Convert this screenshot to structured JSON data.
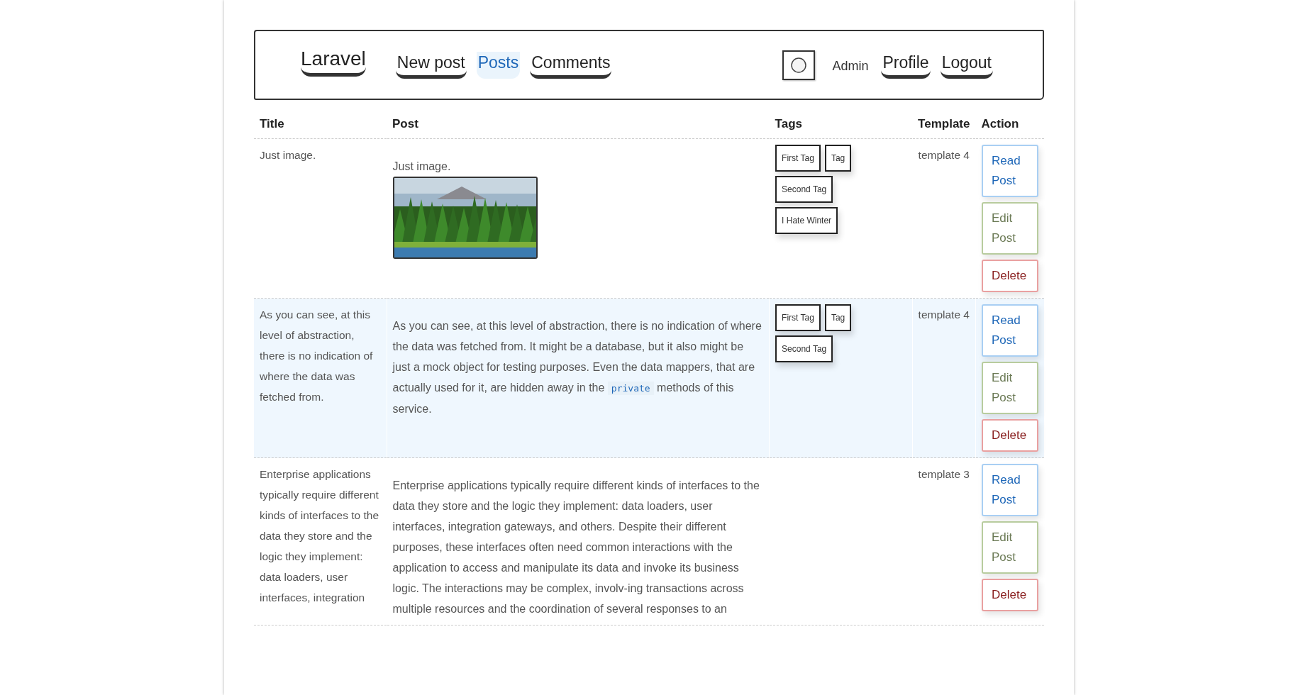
{
  "navbar": {
    "brand": "Laravel",
    "links": [
      {
        "label": "New post",
        "active": false
      },
      {
        "label": "Posts",
        "active": true
      },
      {
        "label": "Comments",
        "active": false
      }
    ],
    "user": {
      "name": "Admin"
    },
    "user_links": [
      {
        "label": "Profile",
        "active": false
      },
      {
        "label": "Logout",
        "active": false
      }
    ]
  },
  "table": {
    "columns": [
      "Title",
      "Post",
      "Tags",
      "Template",
      "Action"
    ],
    "rows": [
      {
        "highlighted": false,
        "title": "Just image.",
        "post": [
          {
            "kind": "text",
            "text": "Just image."
          }
        ],
        "media": [
          {
            "kind": "picture"
          }
        ],
        "tags": [
          "First Tag",
          "Tag",
          "Second Tag",
          "I Hate Winter"
        ],
        "template": "template 4",
        "actions": [
          {
            "kind": "read",
            "label": "Read Post"
          },
          {
            "kind": "edit",
            "label": "Edit Post"
          },
          {
            "kind": "delete",
            "label": "Delete"
          }
        ]
      },
      {
        "highlighted": true,
        "title": "As you can see, at this level of abstraction, there is no indication of where the data was fetched from.",
        "post": [
          {
            "kind": "text",
            "text": "As you can see, at this level of abstraction, there is no indication of where the data was fetched from. It might be a database, but it also might be just a mock object for testing purposes. Even the data mappers, that are actually used for it, are hidden away in the "
          },
          {
            "kind": "code",
            "text": "private"
          },
          {
            "kind": "text",
            "text": " methods of this service."
          }
        ],
        "tags": [
          "First Tag",
          "Tag",
          "Second Tag"
        ],
        "template": "template 4",
        "actions": [
          {
            "kind": "read",
            "label": "Read Post"
          },
          {
            "kind": "edit",
            "label": "Edit Post"
          },
          {
            "kind": "delete",
            "label": "Delete"
          }
        ]
      },
      {
        "highlighted": false,
        "title": "Enterprise applications typically require different kinds of interfaces to the data they store and the logic they implement: data loaders, user interfaces, integration",
        "post": [
          {
            "kind": "text",
            "text": "Enterprise applications typically require different kinds of interfaces to the data they store and the logic they implement: data loaders, user interfaces, integration gateways, and others. Despite their different purposes, these interfaces often need common interactions with the application to access and manipulate its data and invoke its business logic. The interactions may be complex, involv-ing transactions across multiple resources and the coordination of several responses to an"
          }
        ],
        "tags": [],
        "template": "template 3",
        "actions": [
          {
            "kind": "read",
            "label": "Read Post"
          },
          {
            "kind": "edit",
            "label": "Edit Post"
          },
          {
            "kind": "delete",
            "label": "Delete"
          }
        ]
      }
    ]
  }
}
